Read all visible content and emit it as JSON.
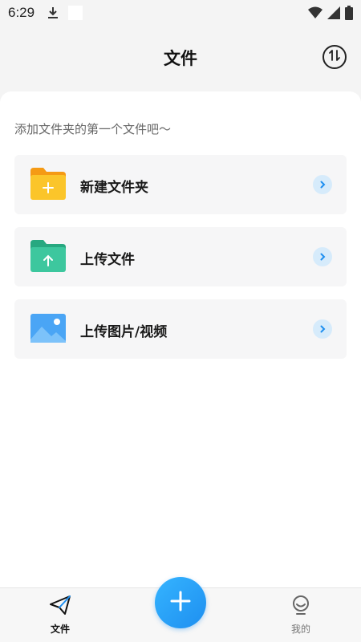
{
  "status_bar": {
    "time": "6:29",
    "icons": [
      "download-icon",
      "white-square-icon",
      "wifi-icon",
      "signal-icon",
      "battery-icon"
    ]
  },
  "header": {
    "title": "文件",
    "sort_icon": "sort-arrows-icon"
  },
  "main": {
    "hint": "添加文件夹的第一个文件吧～",
    "actions": [
      {
        "label": "新建文件夹",
        "icon": "new-folder-icon",
        "color": "#f9c21c"
      },
      {
        "label": "上传文件",
        "icon": "upload-file-icon",
        "color": "#33c49a"
      },
      {
        "label": "上传图片/视频",
        "icon": "upload-image-icon",
        "color": "#4aa5f5"
      }
    ]
  },
  "bottom_nav": {
    "tabs": [
      {
        "label": "文件",
        "icon": "paper-plane-icon",
        "active": true
      },
      {
        "label": "我的",
        "icon": "profile-face-icon",
        "active": false
      }
    ],
    "fab_icon": "plus-icon"
  },
  "colors": {
    "accent": "#1e8ff0",
    "arrow_bg": "#d6ebfb"
  }
}
